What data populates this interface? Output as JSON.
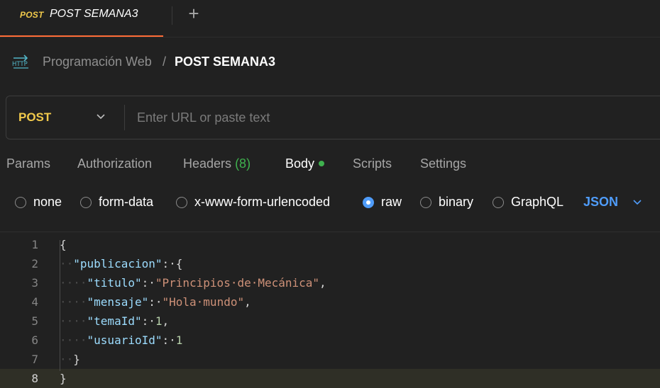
{
  "tab": {
    "method": "POST",
    "title": "POST SEMANA3",
    "add_label": "+"
  },
  "breadcrumb": {
    "icon": "http-icon",
    "parent": "Programación Web",
    "separator": "/",
    "current": "POST SEMANA3"
  },
  "request": {
    "method": "POST",
    "url_value": "",
    "url_placeholder": "Enter URL or paste text"
  },
  "request_tabs": [
    {
      "label": "Params"
    },
    {
      "label": "Authorization"
    },
    {
      "label": "Headers",
      "count": "(8)"
    },
    {
      "label": "Body",
      "active": true
    },
    {
      "label": "Scripts"
    },
    {
      "label": "Settings"
    }
  ],
  "body_types": [
    {
      "label": "none",
      "selected": false
    },
    {
      "label": "form-data",
      "selected": false
    },
    {
      "label": "x-www-form-urlencoded",
      "selected": false
    },
    {
      "label": "raw",
      "selected": true
    },
    {
      "label": "binary",
      "selected": false
    },
    {
      "label": "GraphQL",
      "selected": false
    }
  ],
  "language": "JSON",
  "editor": {
    "current_line": 8,
    "lines": [
      {
        "num": "1",
        "tokens": [
          {
            "t": "{",
            "c": "p"
          }
        ]
      },
      {
        "num": "2",
        "tokens": [
          {
            "t": "··",
            "c": "indent"
          },
          {
            "t": "\"publicacion\"",
            "c": "k"
          },
          {
            "t": ":·{",
            "c": "p"
          }
        ]
      },
      {
        "num": "3",
        "tokens": [
          {
            "t": "····",
            "c": "indent"
          },
          {
            "t": "\"titulo\"",
            "c": "k"
          },
          {
            "t": ":·",
            "c": "p"
          },
          {
            "t": "\"Principios·de·Mecánica\"",
            "c": "s"
          },
          {
            "t": ",",
            "c": "p"
          }
        ]
      },
      {
        "num": "4",
        "tokens": [
          {
            "t": "····",
            "c": "indent"
          },
          {
            "t": "\"mensaje\"",
            "c": "k"
          },
          {
            "t": ":·",
            "c": "p"
          },
          {
            "t": "\"Hola·mundo\"",
            "c": "s"
          },
          {
            "t": ",",
            "c": "p"
          }
        ]
      },
      {
        "num": "5",
        "tokens": [
          {
            "t": "····",
            "c": "indent"
          },
          {
            "t": "\"temaId\"",
            "c": "k"
          },
          {
            "t": ":·",
            "c": "p"
          },
          {
            "t": "1",
            "c": "n"
          },
          {
            "t": ",",
            "c": "p"
          }
        ]
      },
      {
        "num": "6",
        "tokens": [
          {
            "t": "····",
            "c": "indent"
          },
          {
            "t": "\"usuarioId\"",
            "c": "k"
          },
          {
            "t": ":·",
            "c": "p"
          },
          {
            "t": "1",
            "c": "n"
          }
        ]
      },
      {
        "num": "7",
        "tokens": [
          {
            "t": "··",
            "c": "indent"
          },
          {
            "t": "}",
            "c": "p"
          }
        ]
      },
      {
        "num": "8",
        "tokens": [
          {
            "t": "}",
            "c": "p"
          }
        ]
      }
    ]
  },
  "colors": {
    "accent": "#ff6c37",
    "method": "#f0c94b",
    "active_dot": "#3fb14e",
    "link": "#4f9cf9"
  }
}
